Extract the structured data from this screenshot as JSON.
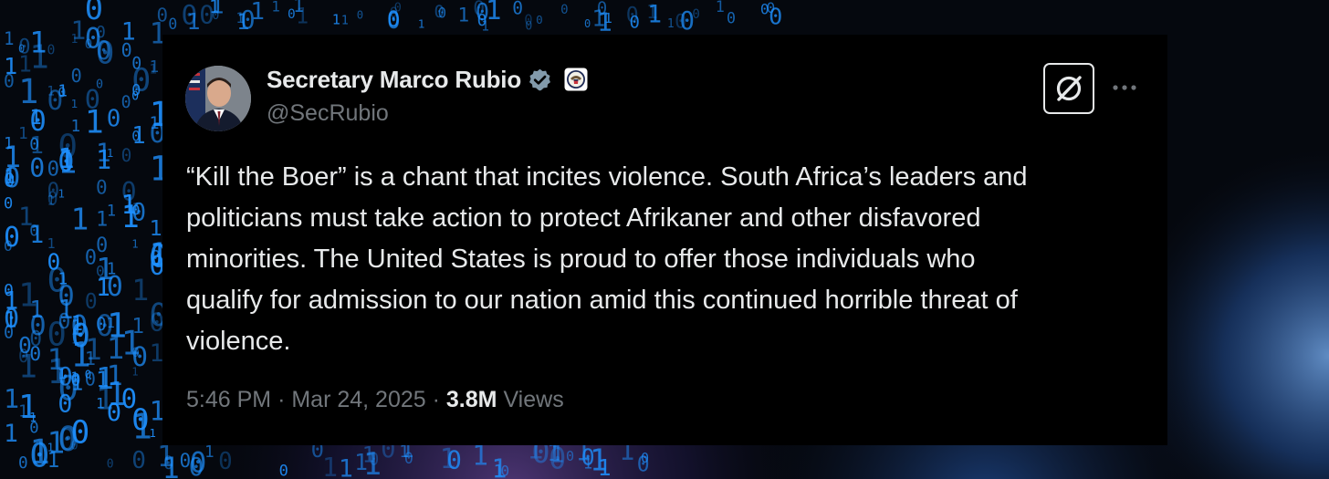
{
  "colors": {
    "card_background": "#000000",
    "primary_text": "#e7e9ea",
    "secondary_text": "#71767b",
    "verified_badge": "#829aab",
    "binary_digits": "#1e90ff"
  },
  "author": {
    "display_name": "Secretary Marco Rubio",
    "handle": "@SecRubio",
    "verified_icon": "verified-badge-icon",
    "affiliation_icon": "state-department-seal-icon"
  },
  "actions": {
    "grok_icon": "grok-icon",
    "more_icon": "more-options-icon"
  },
  "tweet": {
    "lines": [
      "“Kill the Boer” is a chant that incites violence. South Africa’s leaders and",
      "politicians must take action to protect Afrikaner and other disfavored",
      "minorities. The United States is proud to offer those individuals who",
      "qualify for admission to our nation amid this continued horrible threat of",
      "violence."
    ]
  },
  "meta": {
    "time": "5:46 PM",
    "separator": "·",
    "date": "Mar 24, 2025",
    "views_count": "3.8M",
    "views_label": "Views"
  }
}
